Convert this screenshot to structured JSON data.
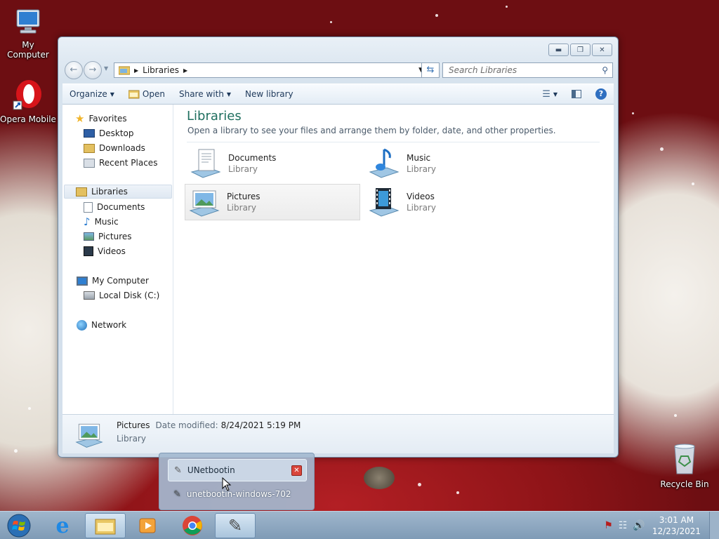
{
  "desktop": {
    "icons": [
      {
        "label": "My Computer",
        "icon": "computer-icon"
      },
      {
        "label": "Opera Mobile",
        "icon": "opera-icon"
      },
      {
        "label": "Recycle Bin",
        "icon": "recycle-bin-icon"
      }
    ]
  },
  "window": {
    "address": {
      "segment": "Libraries"
    },
    "search_placeholder": "Search Libraries",
    "commands": {
      "organize": "Organize",
      "open": "Open",
      "share_with": "Share with",
      "new_library": "New library"
    },
    "nav": {
      "favorites": "Favorites",
      "desktop": "Desktop",
      "downloads": "Downloads",
      "recent_places": "Recent Places",
      "libraries": "Libraries",
      "documents": "Documents",
      "music": "Music",
      "pictures": "Pictures",
      "videos": "Videos",
      "my_computer": "My Computer",
      "local_disk": "Local Disk (C:)",
      "network": "Network"
    },
    "main": {
      "title": "Libraries",
      "subtitle": "Open a library to see your files and arrange them by folder, date, and other properties.",
      "libraries": [
        {
          "name": "Documents",
          "type": "Library"
        },
        {
          "name": "Music",
          "type": "Library"
        },
        {
          "name": "Pictures",
          "type": "Library"
        },
        {
          "name": "Videos",
          "type": "Library"
        }
      ]
    },
    "details": {
      "name": "Pictures",
      "date_label": "Date modified:",
      "date_value": "8/24/2021 5:19 PM",
      "type": "Library"
    }
  },
  "taskbar_popup": {
    "items": [
      {
        "label": "UNetbootin"
      },
      {
        "label": "unetbootin-windows-702"
      }
    ]
  },
  "taskbar": {
    "clock": {
      "time": "3:01 AM",
      "date": "12/23/2021"
    }
  },
  "colors": {
    "title_accent": "#1f6f5f",
    "command_text": "#1e395b"
  }
}
